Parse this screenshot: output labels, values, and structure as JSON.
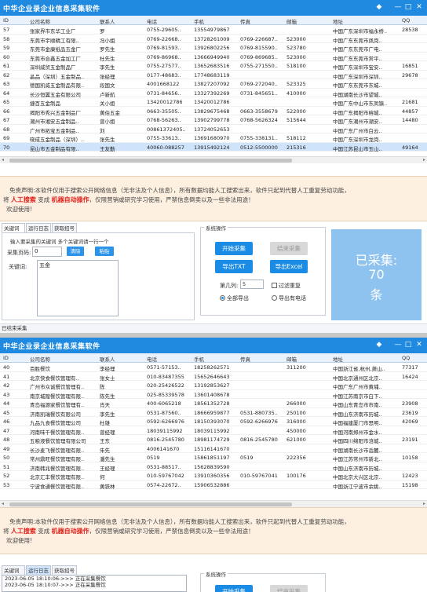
{
  "app": {
    "title": "中华企业录企业信息采集软件",
    "controls": [
      "◆",
      "—",
      "□",
      "✕"
    ]
  },
  "columns": [
    "ID",
    "公司名称",
    "联系人",
    "电话",
    "手机",
    "传真",
    "邮箱",
    "地址",
    "QQ"
  ],
  "table1": [
    {
      "id": "57",
      "name": "张家界市东华工业厂",
      "contact": "罗",
      "tel": "0755-29605..",
      "mob": "13554979867",
      "fax": "",
      "zip": "",
      "addr": "中国广东深圳市福永桥..",
      "qq": "28538"
    },
    {
      "id": "58",
      "name": "东莞市宇顺精工有限..",
      "contact": "冯小姐",
      "tel": "0769-22668..",
      "mob": "13728261009",
      "fax": "0769-226687..",
      "zip": "523000",
      "addr": "中国广东东莞市凤岗..",
      "qq": ""
    },
    {
      "id": "59",
      "name": "东莞市金康纸品五金厂",
      "contact": "罗先生",
      "tel": "0769-81593..",
      "mob": "13926802256",
      "fax": "0769-815590..",
      "zip": "523780",
      "addr": "中国广东东莞市广电..",
      "qq": ""
    },
    {
      "id": "60",
      "name": "东莞市合鑫五金加工厂",
      "contact": "杜先生",
      "tel": "0769-86968..",
      "mob": "13666949940",
      "fax": "0769-869685..",
      "zip": "523000",
      "addr": "中国广东东莞市常平..",
      "qq": ""
    },
    {
      "id": "61",
      "name": "深圳威贸五金制品厂",
      "contact": "李先生",
      "tel": "0755-27577..",
      "mob": "13652683516",
      "fax": "0755-271550..",
      "zip": "518100",
      "addr": "中国广东深圳市宝安..",
      "qq": "16851"
    },
    {
      "id": "62",
      "name": "晶品（深圳）五金制品..",
      "contact": "张经理",
      "tel": "0177-48683..",
      "mob": "17748683119",
      "fax": "",
      "zip": "",
      "addr": "中国广东深圳市深圳..",
      "qq": "29678"
    },
    {
      "id": "63",
      "name": "德国凯威五金制品有限..",
      "contact": "段国文",
      "tel": "4001668122",
      "mob": "13827207092",
      "fax": "0769-272040..",
      "zip": "523325",
      "addr": "中国广东东莞市东城..",
      "qq": ""
    },
    {
      "id": "64",
      "name": "长沙恒翼五金有限公司",
      "contact": "卢新航",
      "tel": "0731-84656..",
      "mob": "13327392269",
      "fax": "0731-845651..",
      "zip": "410000",
      "addr": "中国湖南长沙市望城..",
      "qq": ""
    },
    {
      "id": "65",
      "name": "捷百五金制品",
      "contact": "关小姐",
      "tel": "13420012786",
      "mob": "13420012786",
      "fax": "",
      "zip": "",
      "addr": "中国广东中山市东凤镇..",
      "qq": "21681"
    },
    {
      "id": "66",
      "name": "揭阳市秀兴五金制品厂",
      "contact": "黄伯五金",
      "tel": "0663-35505..",
      "mob": "13829675468",
      "fax": "0663-3558679",
      "zip": "522000",
      "addr": "中国广东揭阳市榕城..",
      "qq": "44857"
    },
    {
      "id": "67",
      "name": "潮州市湘安五金制品..",
      "contact": "曾小姐",
      "tel": "0768-56263..",
      "mob": "13902799778",
      "fax": "0768-5626324",
      "zip": "515644",
      "addr": "中国广东潮州市潮安..",
      "qq": "14480"
    },
    {
      "id": "68",
      "name": "广州市拓宝五金制品..",
      "contact": "刘",
      "tel": "00861372405..",
      "mob": "13724052653",
      "fax": "",
      "zip": "",
      "addr": "中国广东广州市白云..",
      "qq": ""
    },
    {
      "id": "69",
      "name": "晓成五金制品（深圳）..",
      "contact": "张先生",
      "tel": "0755-33613..",
      "mob": "13691680970",
      "fax": "0755-338131..",
      "zip": "518112",
      "addr": "中国广东深圳市龙岗..",
      "qq": ""
    },
    {
      "id": "70",
      "name": "昆山市五金制品有限..",
      "contact": "王友勤",
      "tel": "40060-088257",
      "mob": "13915492124",
      "fax": "0512-5500000",
      "zip": "215316",
      "addr": "中国江苏昆山市玉山..",
      "qq": "49164"
    }
  ],
  "table2": [
    {
      "id": "40",
      "name": "百胜餐饮",
      "contact": "李经理",
      "tel": "0571-57153..",
      "mob": "18258262571",
      "fax": "",
      "zip": "311200",
      "addr": "中国浙江省,杭州,萧山..",
      "qq": "77317"
    },
    {
      "id": "41",
      "name": "北京快食餐饮管理有..",
      "contact": "张女士",
      "tel": "010-83487355",
      "mob": "15652646643",
      "fax": "",
      "zip": "",
      "addr": "中国北京通州区北京..",
      "qq": "16424"
    },
    {
      "id": "42",
      "name": "广州市众诚餐饮管理有..",
      "contact": "陈",
      "tel": "020-25426522",
      "mob": "13192853627",
      "fax": "",
      "zip": "",
      "addr": "中国广东广州市黄埔..",
      "qq": ""
    },
    {
      "id": "43",
      "name": "南京城隍餐饮管理有限..",
      "contact": "陈先生",
      "tel": "025-85339578",
      "mob": "13601408678",
      "fax": "",
      "zip": "",
      "addr": "中国江苏南京市白下..",
      "qq": ""
    },
    {
      "id": "44",
      "name": "青岛福源家餐饮管理有..",
      "contact": "肖天",
      "tel": "400-6065218",
      "mob": "18561352728",
      "fax": "",
      "zip": "266000",
      "addr": "中国山东青岛市市南..",
      "qq": "23908"
    },
    {
      "id": "45",
      "name": "济南凯瑞餐饮有限公司",
      "contact": "李先生",
      "tel": "0531-87560..",
      "mob": "18666959877",
      "fax": "0531-880735..",
      "zip": "250100",
      "addr": "中国山东济南市历城..",
      "qq": "23619"
    },
    {
      "id": "46",
      "name": "九品九食餐饮管理公司",
      "contact": "杜雄",
      "tel": "0592-6266976",
      "mob": "18150393070",
      "fax": "0592-6266976",
      "zip": "316000",
      "addr": "中国福建厦门市思明..",
      "qq": "42069"
    },
    {
      "id": "47",
      "name": "河南味千餐饮管理有限..",
      "contact": "曾经理",
      "tel": "18039115992",
      "mob": "18039115992",
      "fax": "",
      "zip": "450000",
      "addr": "中国河南郑州市金水..",
      "qq": ""
    },
    {
      "id": "48",
      "name": "五粮液餐饮管理有限公司",
      "contact": "王东",
      "tel": "0816-2545780",
      "mob": "18981174729",
      "fax": "0816-2545780",
      "zip": "621000",
      "addr": "中国四川绵阳市涪城..",
      "qq": "23191"
    },
    {
      "id": "49",
      "name": "长沙麦飞餐饮管理有限..",
      "contact": "朱先",
      "tel": "4006141670",
      "mob": "15116141670",
      "fax": "",
      "zip": "",
      "addr": "中国湖南长沙市岳麓..",
      "qq": ""
    },
    {
      "id": "50",
      "name": "常州鼎旺餐饮管理有限..",
      "contact": "潘先生",
      "tel": "0519",
      "mob": "15861851197",
      "fax": "0519",
      "zip": "222356",
      "addr": "中国江苏常州市新北..",
      "qq": "10158"
    },
    {
      "id": "51",
      "name": "济南韩兆餐饮管理有限..",
      "contact": "王经理",
      "tel": "0531-88517..",
      "mob": "15628839590",
      "fax": "",
      "zip": "",
      "addr": "中国山东济南市历城..",
      "qq": ""
    },
    {
      "id": "52",
      "name": "北京汇丰餐饮管理有限..",
      "contact": "何",
      "tel": "010-59767042",
      "mob": "13910360356",
      "fax": "010-59767041",
      "zip": "100176",
      "addr": "中国北京大兴区北京..",
      "qq": "12423"
    },
    {
      "id": "53",
      "name": "宁波食通餐饮管理有限..",
      "contact": "黄铁林",
      "tel": "0574-22672..",
      "mob": "15906532886",
      "fax": "",
      "zip": "",
      "addr": "中国浙江宁波市余姚..",
      "qq": "15198"
    }
  ],
  "disclaimer": {
    "line1": "免责声明:本软件仅用于搜索公开网络信息（无非法及个人信息），所有数据均能人工搜索出来，软件只起到代替人工重复劳动功能，",
    "line2_prefix": "将",
    "line2_hl1": "人工搜索",
    "line2_mid": "变成",
    "line2_hl2": "机器自动操作",
    "line2_suffix": "，仅限营销或研究学习使用，严禁信息倒卖以及一些非法用途！",
    "line3": "欢迎使用!"
  },
  "tabs": [
    "关键词",
    "运行日志",
    "获取招号"
  ],
  "keyword_panel": {
    "group_title": "输入要采集的关键词 多个关键词请一行一个",
    "pages_label": "采集页码:",
    "pages_value": "0",
    "clear_label": "清除",
    "paste_label": "粘贴",
    "keyword_label": "关键词:",
    "keyword_value": "五金"
  },
  "system_ops": {
    "title": "系统操作",
    "start": "开始采集",
    "stop": "结束采集",
    "export_txt": "导出TXT",
    "export_excel": "导出Excel",
    "count_label": "第几列:",
    "count_value": "5",
    "filter_label": "过滤重复",
    "export_all": "全部导出",
    "export_phone": "导出有电话"
  },
  "counter": {
    "label": "已采集:",
    "value": "70",
    "unit": "条"
  },
  "status_text": "已结束采集",
  "log": [
    "2023-06-05 18:10:06->>> 正在采集餐饮",
    "2023-06-05 18:10:07->>> 正在采集餐饮"
  ],
  "colors": {
    "title_blue": "#1f8ae0",
    "button_blue": "#1b8ce6",
    "counter_bg": "#8ec3ef",
    "highlight_red": "#e0201b",
    "disclaimer_bg": "#fdf0e1"
  }
}
